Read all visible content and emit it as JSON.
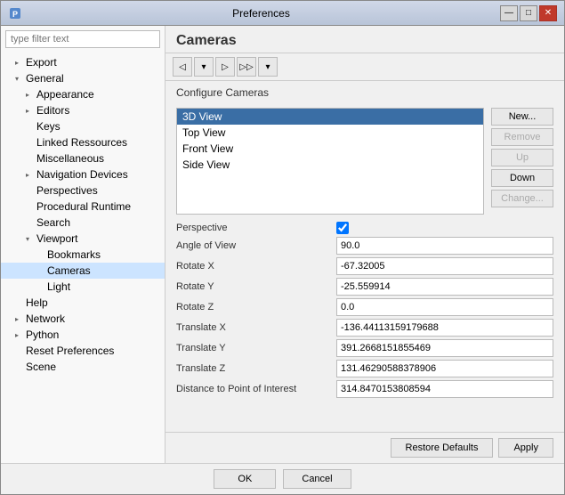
{
  "window": {
    "title": "Preferences",
    "icon": "prefs-icon"
  },
  "title_buttons": {
    "minimize": "—",
    "maximize": "□",
    "close": "✕"
  },
  "sidebar": {
    "filter_placeholder": "type filter text",
    "tree": [
      {
        "id": "export",
        "label": "Export",
        "level": 1,
        "indent": "indent-1",
        "arrow": "closed",
        "selected": false
      },
      {
        "id": "general",
        "label": "General",
        "level": 1,
        "indent": "indent-1",
        "arrow": "open",
        "selected": false
      },
      {
        "id": "appearance",
        "label": "Appearance",
        "level": 2,
        "indent": "indent-2",
        "arrow": "closed",
        "selected": false
      },
      {
        "id": "editors",
        "label": "Editors",
        "level": 2,
        "indent": "indent-2",
        "arrow": "closed",
        "selected": false
      },
      {
        "id": "keys",
        "label": "Keys",
        "level": 3,
        "indent": "indent-2",
        "arrow": "leaf",
        "selected": false
      },
      {
        "id": "linked-resources",
        "label": "Linked Ressources",
        "level": 3,
        "indent": "indent-2",
        "arrow": "leaf",
        "selected": false
      },
      {
        "id": "miscellaneous",
        "label": "Miscellaneous",
        "level": 3,
        "indent": "indent-2",
        "arrow": "leaf",
        "selected": false
      },
      {
        "id": "navigation-devices",
        "label": "Navigation Devices",
        "level": 2,
        "indent": "indent-2",
        "arrow": "closed",
        "selected": false
      },
      {
        "id": "perspectives",
        "label": "Perspectives",
        "level": 3,
        "indent": "indent-2",
        "arrow": "leaf",
        "selected": false
      },
      {
        "id": "procedural-runtime",
        "label": "Procedural Runtime",
        "level": 3,
        "indent": "indent-2",
        "arrow": "leaf",
        "selected": false
      },
      {
        "id": "search",
        "label": "Search",
        "level": 3,
        "indent": "indent-2",
        "arrow": "leaf",
        "selected": false
      },
      {
        "id": "viewport",
        "label": "Viewport",
        "level": 2,
        "indent": "indent-2",
        "arrow": "open",
        "selected": false
      },
      {
        "id": "bookmarks",
        "label": "Bookmarks",
        "level": 3,
        "indent": "indent-3",
        "arrow": "leaf",
        "selected": false
      },
      {
        "id": "cameras",
        "label": "Cameras",
        "level": 3,
        "indent": "indent-3",
        "arrow": "leaf",
        "selected": true
      },
      {
        "id": "light",
        "label": "Light",
        "level": 3,
        "indent": "indent-3",
        "arrow": "leaf",
        "selected": false
      },
      {
        "id": "help",
        "label": "Help",
        "level": 1,
        "indent": "indent-1",
        "arrow": "leaf",
        "selected": false
      },
      {
        "id": "network",
        "label": "Network",
        "level": 1,
        "indent": "indent-1",
        "arrow": "closed",
        "selected": false
      },
      {
        "id": "python",
        "label": "Python",
        "level": 1,
        "indent": "indent-1",
        "arrow": "closed",
        "selected": false
      },
      {
        "id": "reset-preferences",
        "label": "Reset Preferences",
        "level": 1,
        "indent": "indent-1",
        "arrow": "leaf",
        "selected": false
      },
      {
        "id": "scene",
        "label": "Scene",
        "level": 1,
        "indent": "indent-1",
        "arrow": "leaf",
        "selected": false
      }
    ]
  },
  "main": {
    "title": "Cameras",
    "subtitle": "Configure Cameras",
    "camera_list": [
      {
        "label": "3D View",
        "selected": true
      },
      {
        "label": "Top View",
        "selected": false
      },
      {
        "label": "Front View",
        "selected": false
      },
      {
        "label": "Side View",
        "selected": false
      }
    ],
    "buttons": {
      "new": "New...",
      "remove": "Remove",
      "up": "Up",
      "down": "Down",
      "change": "Change..."
    },
    "properties": [
      {
        "label": "Perspective",
        "value": "",
        "type": "checkbox",
        "checked": true
      },
      {
        "label": "Angle of View",
        "value": "90.0",
        "type": "text"
      },
      {
        "label": "Rotate X",
        "value": "-67.32005",
        "type": "text"
      },
      {
        "label": "Rotate Y",
        "value": "-25.559914",
        "type": "text"
      },
      {
        "label": "Rotate Z",
        "value": "0.0",
        "type": "text"
      },
      {
        "label": "Translate X",
        "value": "-136.44113159179688",
        "type": "text"
      },
      {
        "label": "Translate Y",
        "value": "391.2668151855469",
        "type": "text"
      },
      {
        "label": "Translate Z",
        "value": "131.46290588378906",
        "type": "text"
      },
      {
        "label": "Distance to Point of Interest",
        "value": "314.8470153808594",
        "type": "text"
      }
    ],
    "restore_defaults": "Restore Defaults",
    "apply": "Apply"
  },
  "footer": {
    "ok": "OK",
    "cancel": "Cancel"
  }
}
